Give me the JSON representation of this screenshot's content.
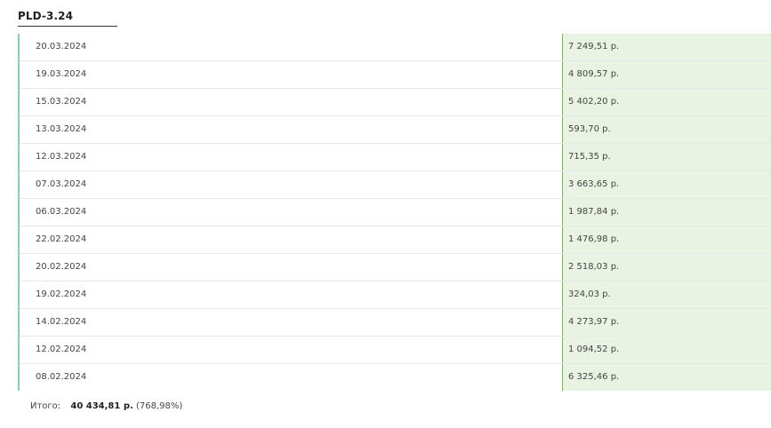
{
  "header": {
    "title": "PLD-3.24"
  },
  "payments": [
    {
      "date": "20.03.2024",
      "amount": "7 249,51 р."
    },
    {
      "date": "19.03.2024",
      "amount": "4 809,57 р."
    },
    {
      "date": "15.03.2024",
      "amount": "5 402,20 р."
    },
    {
      "date": "13.03.2024",
      "amount": "593,70 р."
    },
    {
      "date": "12.03.2024",
      "amount": "715,35 р."
    },
    {
      "date": "07.03.2024",
      "amount": "3 663,65 р."
    },
    {
      "date": "06.03.2024",
      "amount": "1 987,84 р."
    },
    {
      "date": "22.02.2024",
      "amount": "1 476,98 р."
    },
    {
      "date": "20.02.2024",
      "amount": "2 518,03 р."
    },
    {
      "date": "19.02.2024",
      "amount": "324,03 р."
    },
    {
      "date": "14.02.2024",
      "amount": "4 273,97 р."
    },
    {
      "date": "12.02.2024",
      "amount": "1 094,52 р."
    },
    {
      "date": "08.02.2024",
      "amount": "6 325,46 р."
    }
  ],
  "total": {
    "label": "Итого:",
    "sum": "40 434,81 р.",
    "percent": "(768,98%)"
  },
  "colors": {
    "accent_border": "#8fc7c1",
    "amount_bg": "#e9f3e3",
    "amount_border": "#7fb068"
  }
}
